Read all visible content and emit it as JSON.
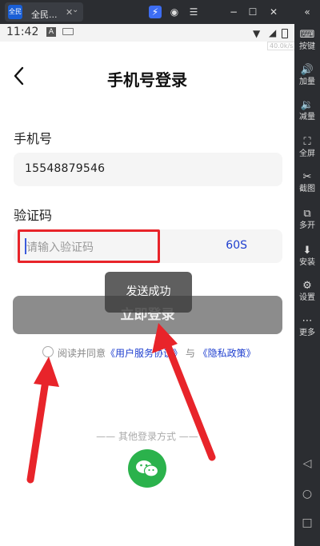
{
  "emulator": {
    "tab_title": "全民...",
    "tab_close": "✕",
    "tab_dropdown": "⌄",
    "app_logo_text": "全民",
    "sidebar": [
      {
        "icon": "keyboard-icon",
        "glyph": "⌨",
        "label": "按键"
      },
      {
        "icon": "volume-up-icon",
        "glyph": "🔊",
        "label": "加量"
      },
      {
        "icon": "volume-down-icon",
        "glyph": "🔉",
        "label": "减量"
      },
      {
        "icon": "fullscreen-icon",
        "glyph": "⛶",
        "label": "全屏"
      },
      {
        "icon": "scissors-icon",
        "glyph": "✂",
        "label": "截图"
      },
      {
        "icon": "multi-instance-icon",
        "glyph": "⧉",
        "label": "多开"
      },
      {
        "icon": "apk-install-icon",
        "glyph": "⬇",
        "label": "安装"
      },
      {
        "icon": "settings-icon",
        "glyph": "⚙",
        "label": "设置"
      },
      {
        "icon": "more-icon",
        "glyph": "⋯",
        "label": "更多"
      }
    ],
    "nav": {
      "back": "◁",
      "home": "○",
      "recent": "□"
    }
  },
  "status_bar": {
    "time": "11:42",
    "a_icon": "A",
    "speed_badge": "40.0k/s"
  },
  "header": {
    "title": "手机号登录"
  },
  "form": {
    "phone_label": "手机号",
    "phone_value": "15548879546",
    "code_label": "验证码",
    "code_placeholder": "请输入验证码",
    "countdown": "60S",
    "login_button": "立即登录"
  },
  "toast": {
    "text": "发送成功"
  },
  "agreement": {
    "prefix": "阅读并同意",
    "terms": "《用户服务协议》",
    "and": " 与 ",
    "privacy": "《隐私政策》"
  },
  "other_login": {
    "label": "—— 其他登录方式 ——"
  },
  "colors": {
    "accent": "#1f3fcf",
    "wechat": "#2bb24c",
    "annotation": "#e8242a",
    "button_disabled": "#8c8c8c"
  }
}
